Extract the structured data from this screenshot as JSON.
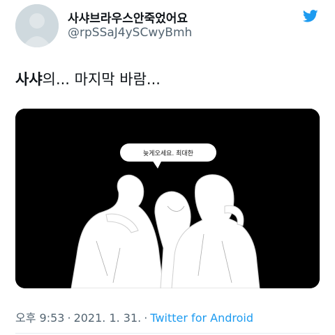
{
  "author": {
    "display_name": "사샤브라우스안죽었어요",
    "handle": "@rpSSaJ4ySCwyBmh",
    "avatar": "default-avatar-silhouette"
  },
  "brand": {
    "icon": "twitter-bird-icon",
    "color": "#1d9bf0"
  },
  "tweet": {
    "text_bold": "사샤",
    "text_rest": "의... 마지막 바람..."
  },
  "media": {
    "speech_bubble": "늦게오세요. 최대한",
    "background": "#000000"
  },
  "meta": {
    "time": "오후 9:53",
    "separator": "·",
    "date": "2021. 1. 31.",
    "source": "Twitter for Android"
  },
  "colors": {
    "text_primary": "#0f1419",
    "text_secondary": "#536471",
    "link": "#1d9bf0"
  }
}
